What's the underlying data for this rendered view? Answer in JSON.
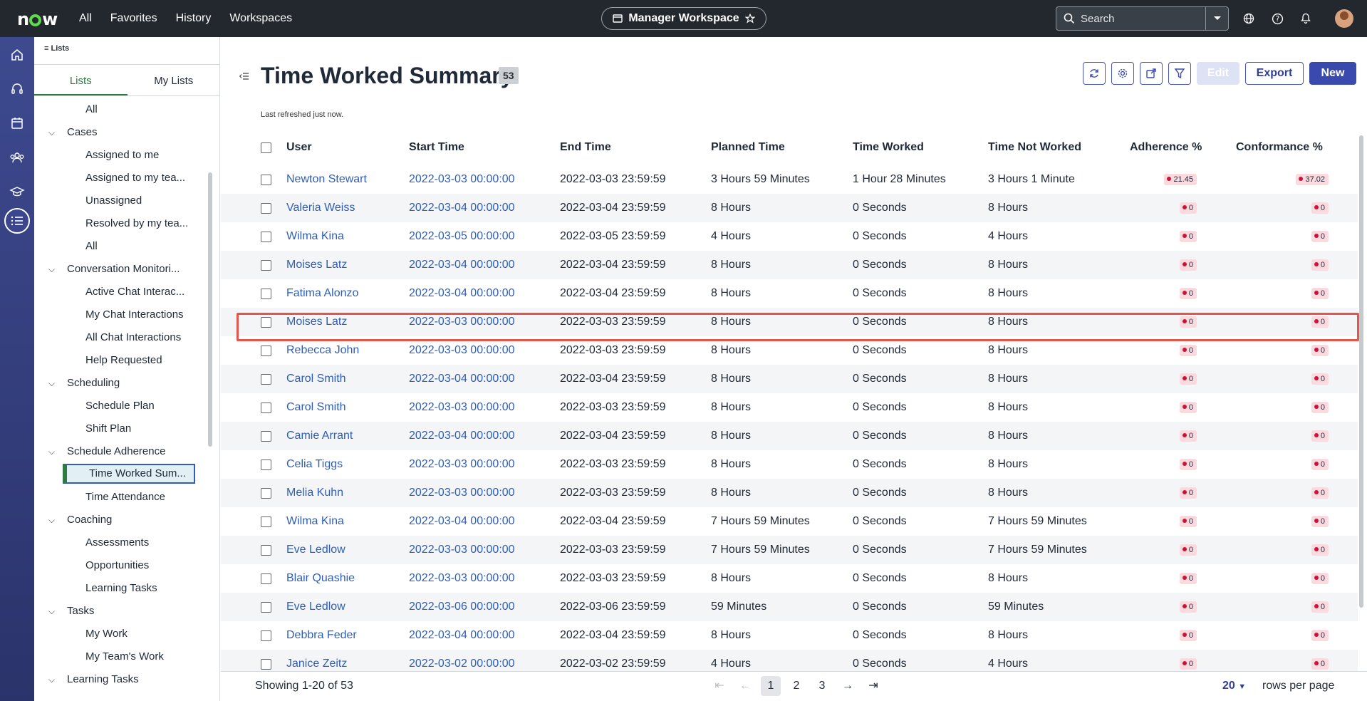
{
  "topbar": {
    "logo": "now",
    "nav": [
      "All",
      "Favorites",
      "History",
      "Workspaces"
    ],
    "workspace": "Manager Workspace",
    "search_placeholder": "Search"
  },
  "breadcrumb": "Lists",
  "nav_tabs": [
    "Lists",
    "My Lists"
  ],
  "nav_tree": [
    {
      "type": "item",
      "label": "All"
    },
    {
      "type": "group",
      "label": "Cases"
    },
    {
      "type": "item",
      "label": "Assigned to me"
    },
    {
      "type": "item",
      "label": "Assigned to my tea..."
    },
    {
      "type": "item",
      "label": "Unassigned"
    },
    {
      "type": "item",
      "label": "Resolved by my tea..."
    },
    {
      "type": "item",
      "label": "All"
    },
    {
      "type": "group",
      "label": "Conversation Monitori..."
    },
    {
      "type": "item",
      "label": "Active Chat Interac..."
    },
    {
      "type": "item",
      "label": "My Chat Interactions"
    },
    {
      "type": "item",
      "label": "All Chat Interactions"
    },
    {
      "type": "item",
      "label": "Help Requested"
    },
    {
      "type": "group",
      "label": "Scheduling"
    },
    {
      "type": "item",
      "label": "Schedule Plan"
    },
    {
      "type": "item",
      "label": "Shift Plan"
    },
    {
      "type": "group",
      "label": "Schedule Adherence"
    },
    {
      "type": "item",
      "label": "Time Worked Sum...",
      "selected": true
    },
    {
      "type": "item",
      "label": "Time Attendance"
    },
    {
      "type": "group",
      "label": "Coaching"
    },
    {
      "type": "item",
      "label": "Assessments"
    },
    {
      "type": "item",
      "label": "Opportunities"
    },
    {
      "type": "item",
      "label": "Learning Tasks"
    },
    {
      "type": "group",
      "label": "Tasks"
    },
    {
      "type": "item",
      "label": "My Work"
    },
    {
      "type": "item",
      "label": "My Team's Work"
    },
    {
      "type": "group",
      "label": "Learning Tasks"
    }
  ],
  "page": {
    "title": "Time Worked Summary",
    "count": "53",
    "refreshed": "Last refreshed just now.",
    "buttons": {
      "edit": "Edit",
      "export": "Export",
      "new": "New"
    }
  },
  "table": {
    "columns": [
      "User",
      "Start Time",
      "End Time",
      "Planned Time",
      "Time Worked",
      "Time Not Worked",
      "Adherence %",
      "Conformance %"
    ],
    "rows": [
      [
        "Newton Stewart",
        "2022-03-03 00:00:00",
        "2022-03-03 23:59:59",
        "3 Hours 59 Minutes",
        "1 Hour 28 Minutes",
        "3 Hours 1 Minute",
        "21.45",
        "37.02"
      ],
      [
        "Valeria Weiss",
        "2022-03-04 00:00:00",
        "2022-03-04 23:59:59",
        "8 Hours",
        "0 Seconds",
        "8 Hours",
        "0",
        "0"
      ],
      [
        "Wilma Kina",
        "2022-03-05 00:00:00",
        "2022-03-05 23:59:59",
        "4 Hours",
        "0 Seconds",
        "4 Hours",
        "0",
        "0"
      ],
      [
        "Moises Latz",
        "2022-03-04 00:00:00",
        "2022-03-04 23:59:59",
        "8 Hours",
        "0 Seconds",
        "8 Hours",
        "0",
        "0"
      ],
      [
        "Fatima Alonzo",
        "2022-03-04 00:00:00",
        "2022-03-04 23:59:59",
        "8 Hours",
        "0 Seconds",
        "8 Hours",
        "0",
        "0"
      ],
      [
        "Moises Latz",
        "2022-03-03 00:00:00",
        "2022-03-03 23:59:59",
        "8 Hours",
        "0 Seconds",
        "8 Hours",
        "0",
        "0"
      ],
      [
        "Rebecca John",
        "2022-03-03 00:00:00",
        "2022-03-03 23:59:59",
        "8 Hours",
        "0 Seconds",
        "8 Hours",
        "0",
        "0"
      ],
      [
        "Carol Smith",
        "2022-03-04 00:00:00",
        "2022-03-04 23:59:59",
        "8 Hours",
        "0 Seconds",
        "8 Hours",
        "0",
        "0"
      ],
      [
        "Carol Smith",
        "2022-03-03 00:00:00",
        "2022-03-03 23:59:59",
        "8 Hours",
        "0 Seconds",
        "8 Hours",
        "0",
        "0"
      ],
      [
        "Camie Arrant",
        "2022-03-04 00:00:00",
        "2022-03-04 23:59:59",
        "8 Hours",
        "0 Seconds",
        "8 Hours",
        "0",
        "0"
      ],
      [
        "Celia Tiggs",
        "2022-03-03 00:00:00",
        "2022-03-03 23:59:59",
        "8 Hours",
        "0 Seconds",
        "8 Hours",
        "0",
        "0"
      ],
      [
        "Melia Kuhn",
        "2022-03-03 00:00:00",
        "2022-03-03 23:59:59",
        "8 Hours",
        "0 Seconds",
        "8 Hours",
        "0",
        "0"
      ],
      [
        "Wilma Kina",
        "2022-03-04 00:00:00",
        "2022-03-04 23:59:59",
        "7 Hours 59 Minutes",
        "0 Seconds",
        "7 Hours 59 Minutes",
        "0",
        "0"
      ],
      [
        "Eve Ledlow",
        "2022-03-03 00:00:00",
        "2022-03-03 23:59:59",
        "7 Hours 59 Minutes",
        "0 Seconds",
        "7 Hours 59 Minutes",
        "0",
        "0"
      ],
      [
        "Blair Quashie",
        "2022-03-03 00:00:00",
        "2022-03-03 23:59:59",
        "8 Hours",
        "0 Seconds",
        "8 Hours",
        "0",
        "0"
      ],
      [
        "Eve Ledlow",
        "2022-03-06 00:00:00",
        "2022-03-06 23:59:59",
        "59 Minutes",
        "0 Seconds",
        "59 Minutes",
        "0",
        "0"
      ],
      [
        "Debbra Feder",
        "2022-03-04 00:00:00",
        "2022-03-04 23:59:59",
        "8 Hours",
        "0 Seconds",
        "8 Hours",
        "0",
        "0"
      ],
      [
        "Janice Zeitz",
        "2022-03-02 00:00:00",
        "2022-03-02 23:59:59",
        "4 Hours",
        "0 Seconds",
        "4 Hours",
        "0",
        "0"
      ]
    ]
  },
  "footer": {
    "showing": "Showing 1-20 of 53",
    "pages": [
      "1",
      "2",
      "3"
    ],
    "rows_per_page_value": "20",
    "rows_per_page_label": "rows per page"
  },
  "colors": {
    "accent": "#3a49ad",
    "link": "#2e5eb8",
    "selected_nav": "#2f7a42",
    "highlight": "#e4564b",
    "badge_bg": "#fbd9de"
  }
}
